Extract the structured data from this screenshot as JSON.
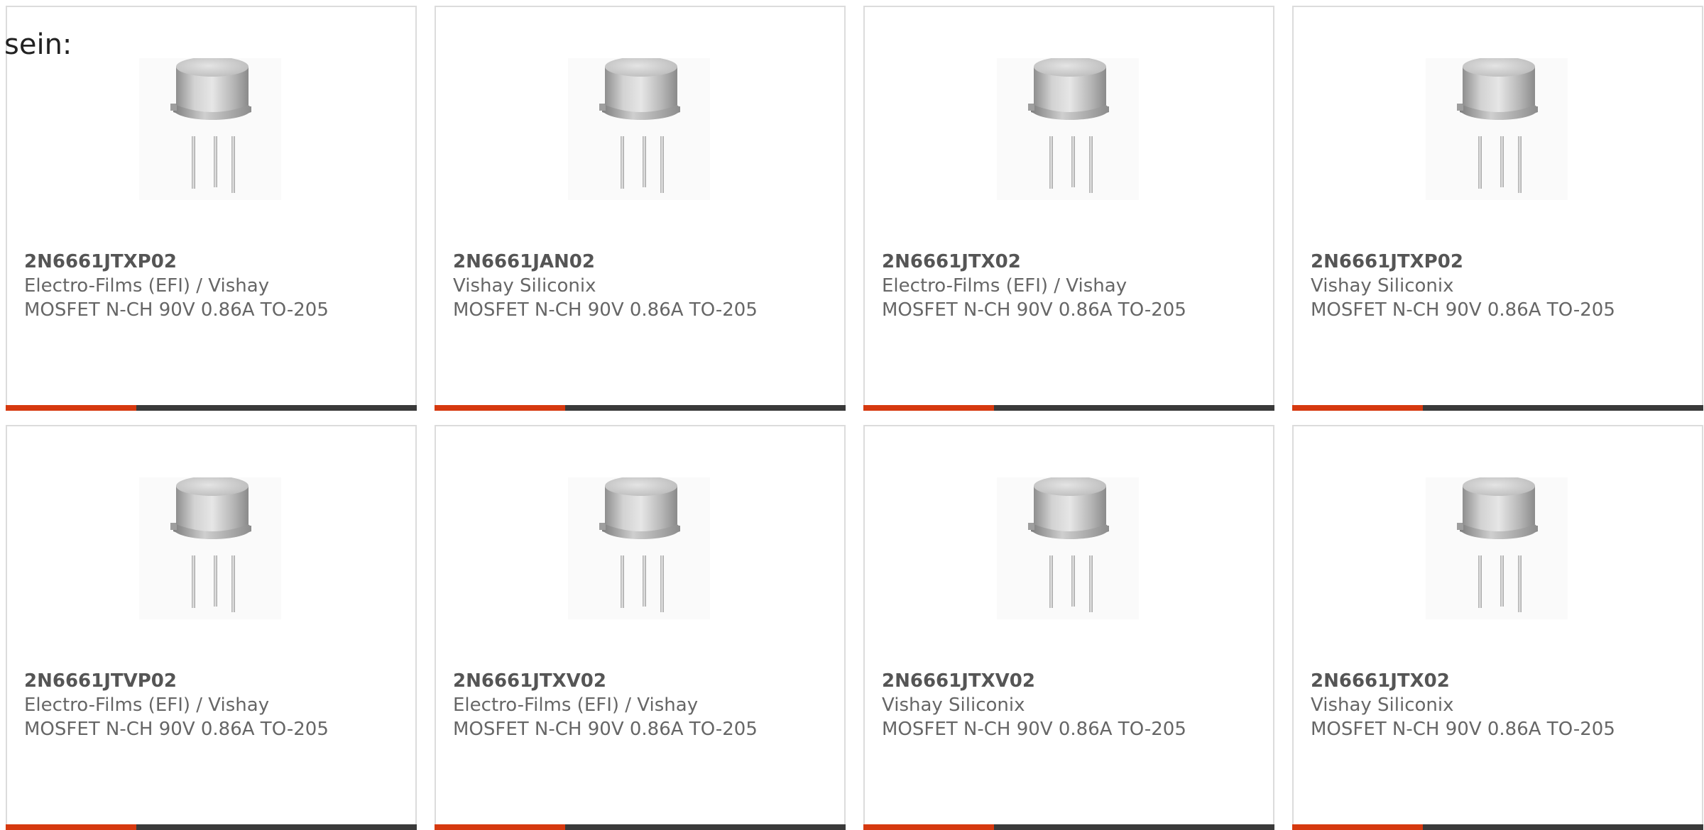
{
  "intro_text": "sein:",
  "colors": {
    "accent": "#d6390f",
    "bar": "#3a3a3a",
    "border": "#dcdcdc"
  },
  "product_image_icon": "to-205-transistor-image",
  "products": [
    {
      "part_number": "2N6661JTXP02",
      "manufacturer": "Electro-Films (EFI) / Vishay",
      "description": "MOSFET N-CH 90V 0.86A TO-205"
    },
    {
      "part_number": "2N6661JAN02",
      "manufacturer": "Vishay Siliconix",
      "description": "MOSFET N-CH 90V 0.86A TO-205"
    },
    {
      "part_number": "2N6661JTX02",
      "manufacturer": "Electro-Films (EFI) / Vishay",
      "description": "MOSFET N-CH 90V 0.86A TO-205"
    },
    {
      "part_number": "2N6661JTXP02",
      "manufacturer": "Vishay Siliconix",
      "description": "MOSFET N-CH 90V 0.86A TO-205"
    },
    {
      "part_number": "2N6661JTVP02",
      "manufacturer": "Electro-Films (EFI) / Vishay",
      "description": "MOSFET N-CH 90V 0.86A TO-205"
    },
    {
      "part_number": "2N6661JTXV02",
      "manufacturer": "Electro-Films (EFI) / Vishay",
      "description": "MOSFET N-CH 90V 0.86A TO-205"
    },
    {
      "part_number": "2N6661JTXV02",
      "manufacturer": "Vishay Siliconix",
      "description": "MOSFET N-CH 90V 0.86A TO-205"
    },
    {
      "part_number": "2N6661JTX02",
      "manufacturer": "Vishay Siliconix",
      "description": "MOSFET N-CH 90V 0.86A TO-205"
    }
  ]
}
